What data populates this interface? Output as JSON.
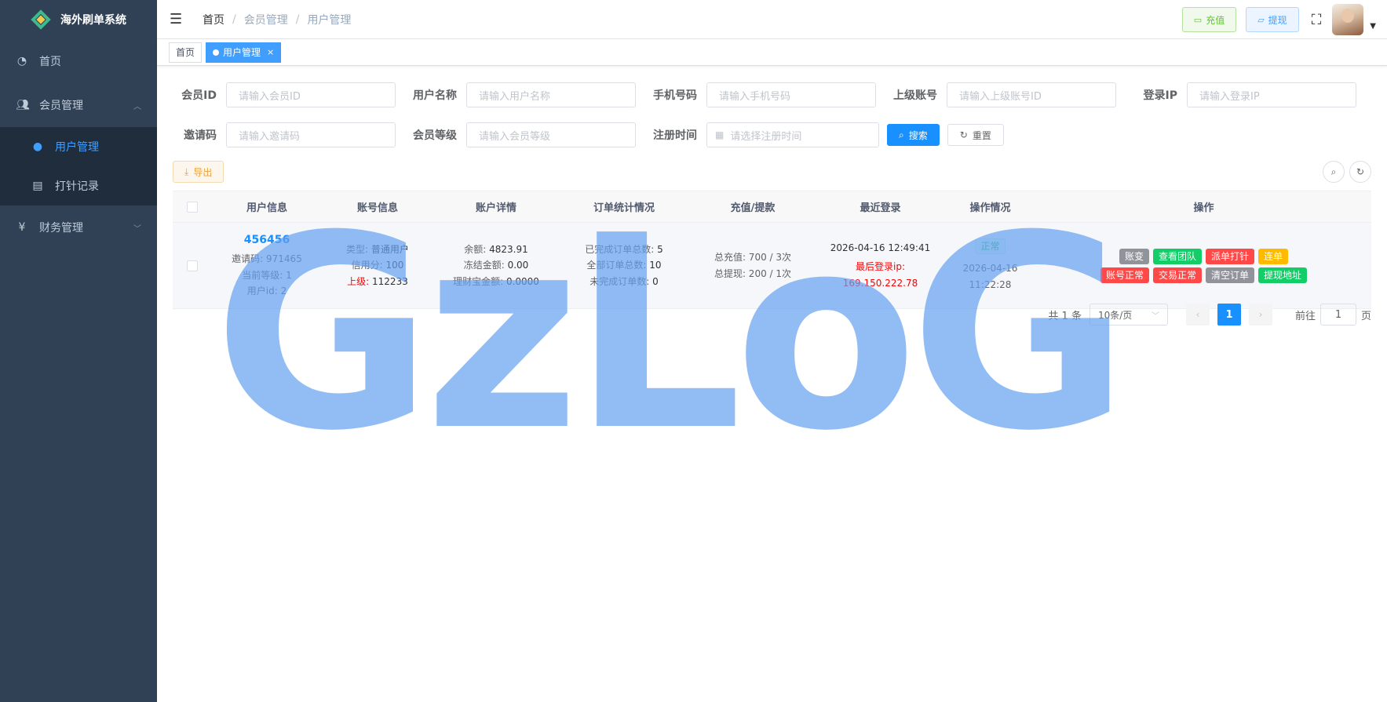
{
  "app": {
    "title": "海外刷单系统"
  },
  "sidebar": {
    "items": [
      {
        "label": "首页",
        "icon": "dashboard-icon"
      },
      {
        "label": "会员管理",
        "icon": "user-group-icon",
        "expanded": true,
        "children": [
          {
            "label": "用户管理",
            "icon": "user-icon",
            "active": true
          },
          {
            "label": "打针记录",
            "icon": "document-icon"
          }
        ]
      },
      {
        "label": "财务管理",
        "icon": "yen-icon",
        "expanded": false
      }
    ]
  },
  "header": {
    "breadcrumb": [
      "首页",
      "会员管理",
      "用户管理"
    ],
    "recharge_label": "充值",
    "withdraw_label": "提现"
  },
  "tags": [
    {
      "label": "首页",
      "active": false
    },
    {
      "label": "用户管理",
      "active": true
    }
  ],
  "filters": {
    "member_id": {
      "label": "会员ID",
      "placeholder": "请输入会员ID"
    },
    "username": {
      "label": "用户名称",
      "placeholder": "请输入用户名称"
    },
    "phone": {
      "label": "手机号码",
      "placeholder": "请输入手机号码"
    },
    "parent": {
      "label": "上级账号",
      "placeholder": "请输入上级账号ID"
    },
    "login_ip": {
      "label": "登录IP",
      "placeholder": "请输入登录IP"
    },
    "invite_code": {
      "label": "邀请码",
      "placeholder": "请输入邀请码"
    },
    "level": {
      "label": "会员等级",
      "placeholder": "请输入会员等级"
    },
    "reg_time": {
      "label": "注册时间",
      "placeholder": "请选择注册时间"
    },
    "search_label": "搜索",
    "reset_label": "重置"
  },
  "toolbar": {
    "export_label": "导出"
  },
  "table": {
    "headers": [
      "用户信息",
      "账号信息",
      "账户详情",
      "订单统计情况",
      "充值/提款",
      "最近登录",
      "操作情况",
      "操作"
    ],
    "rows": [
      {
        "user": {
          "name": "456456",
          "invite": "邀请码: 971465",
          "level": "当前等级: 1",
          "uid": "用户id: 2"
        },
        "account": {
          "type_label": "类型:",
          "type": "普通用户",
          "credit_label": "信用分:",
          "credit": "100",
          "parent_label": "上级:",
          "parent": "112233"
        },
        "detail": {
          "balance_label": "余额:",
          "balance": "4823.91",
          "frozen_label": "冻结金额:",
          "frozen": "0.00",
          "wealth_label": "理财宝金额:",
          "wealth": "0.0000"
        },
        "orders": {
          "done_label": "已完成订单总数:",
          "done": "5",
          "all_label": "全部订单总数:",
          "all": "10",
          "undone_label": "未完成订单数:",
          "undone": "0"
        },
        "funds": {
          "recharge": "总充值: 700 / 3次",
          "withdraw": "总提现: 200 / 1次"
        },
        "login": {
          "time": "2026-04-16 12:49:41",
          "ip_label": "最后登录ip:",
          "ip": "169.150.222.78"
        },
        "status": {
          "tag": "正常",
          "time": "2026-04-16 11:22:28"
        },
        "actions": [
          [
            {
              "label": "账变",
              "color": "#909399"
            },
            {
              "label": "查看团队",
              "color": "#13ce66"
            },
            {
              "label": "派单打针",
              "color": "#ff4949"
            },
            {
              "label": "连单",
              "color": "#ffba00"
            }
          ],
          [
            {
              "label": "账号正常",
              "color": "#ff4949"
            },
            {
              "label": "交易正常",
              "color": "#ff4949"
            },
            {
              "label": "清空订单",
              "color": "#909399"
            },
            {
              "label": "提现地址",
              "color": "#13ce66"
            }
          ]
        ]
      }
    ]
  },
  "pagination": {
    "total": "共 1 条",
    "page_size": "10条/页",
    "current_page": "1",
    "goto_label": "前往",
    "goto_value": "1",
    "page_suffix": "页"
  },
  "watermark": "GzLoG"
}
